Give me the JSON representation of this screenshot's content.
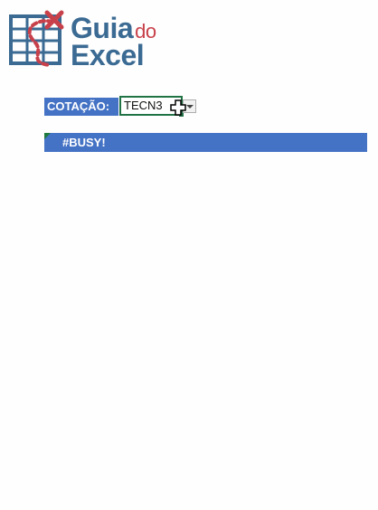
{
  "logo": {
    "word_line1": "Guia",
    "word_line1_suffix": "do",
    "word_line2": "Excel",
    "primary_color": "#3b6a93",
    "accent_color": "#c8404a"
  },
  "form": {
    "label": "COTAÇÃO:",
    "value": "TECN3",
    "dropdown_icon": "chevron-down-icon"
  },
  "result": {
    "text": "#BUSY!"
  },
  "colors": {
    "header_fill": "#4472c4",
    "selection_border": "#217346"
  }
}
